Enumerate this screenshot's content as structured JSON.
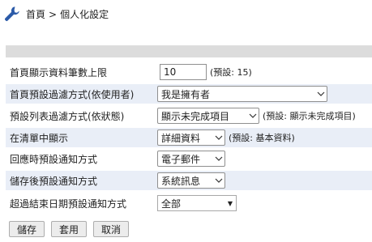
{
  "breadcrumb": {
    "home": "首頁",
    "separator": ">",
    "current": "個人化設定"
  },
  "form": {
    "home_count": {
      "label": "首頁顯示資料筆數上限",
      "value": "10",
      "hint": "(預設: 15)"
    },
    "home_filter": {
      "label": "首頁預設過濾方式(依使用者)",
      "value": "我是擁有者"
    },
    "list_filter": {
      "label": "預設列表過濾方式(依狀態)",
      "value": "顯示未完成項目",
      "hint": "(預設: 顯示未完成項目)"
    },
    "list_display": {
      "label": "在清單中顯示",
      "value": "詳細資料",
      "hint": "(預設: 基本資料)"
    },
    "reply_notify": {
      "label": "回應時預設通知方式",
      "value": "電子郵件"
    },
    "save_notify": {
      "label": "儲存後預設通知方式",
      "value": "系統訊息"
    },
    "overdue_notify": {
      "label": "超過結束日期預設通知方式",
      "value": "全部"
    }
  },
  "buttons": {
    "save": "儲存",
    "apply": "套用",
    "cancel": "取消"
  },
  "colors": {
    "row_alt": "#e9eef7",
    "bar": "#dcdcdc",
    "icon": "#2b5aa8"
  }
}
